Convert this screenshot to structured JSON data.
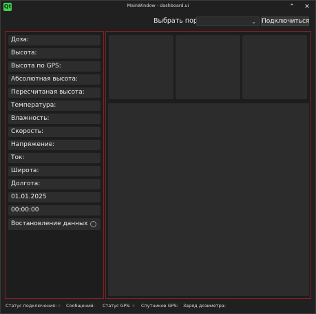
{
  "window": {
    "title": "MainWindow - dashboard.ui",
    "app_icon_text": "Qt",
    "minimize_glyph": "⌃",
    "close_glyph": "✕"
  },
  "toolbar": {
    "port_label": "Выбрать порт:",
    "port_value": "",
    "connect_label": "Подключиться"
  },
  "fields": [
    {
      "label": "Доза:"
    },
    {
      "label": "Высота:"
    },
    {
      "label": "Высота по GPS:"
    },
    {
      "label": "Абсолютная высота:"
    },
    {
      "label": "Пересчитаная высота:"
    },
    {
      "label": "Температура:"
    },
    {
      "label": "Влажность:"
    },
    {
      "label": "Скорость:"
    },
    {
      "label": "Напряжение:"
    },
    {
      "label": "Ток:"
    },
    {
      "label": "Широта:"
    },
    {
      "label": "Долгота:"
    },
    {
      "label": "01.01.2025"
    },
    {
      "label": "00:00:00"
    },
    {
      "label": "Востановление данных",
      "checked": false
    }
  ],
  "statusbar": {
    "connection": "Статус подключения:",
    "messages": "Сообщений:",
    "gps_status": "Статус GPS:",
    "gps_sats": "Спутников GPS:",
    "dosimeter_charge": "Заряд дозиметра:"
  },
  "colors": {
    "panel_border": "#8a1e24",
    "card": "#2c2c2c",
    "background": "#202020"
  }
}
